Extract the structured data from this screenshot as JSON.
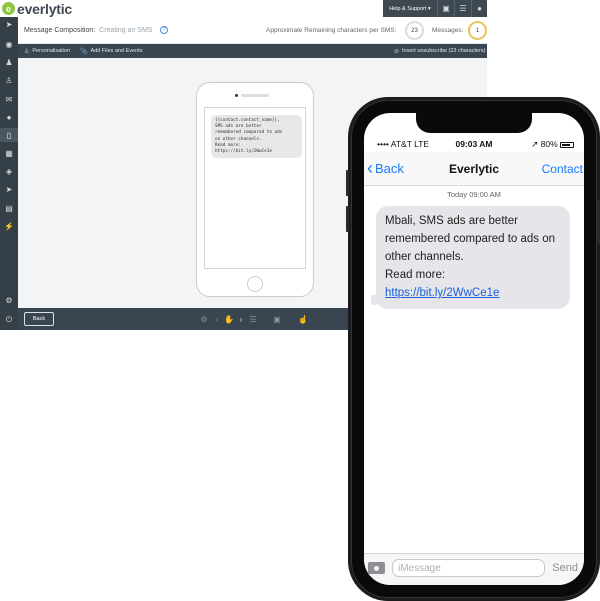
{
  "app": {
    "brand": "everlytic",
    "brand_mark": "e",
    "help_label": "Help & Support ▾",
    "header": {
      "title": "Message Composition:",
      "subtitle": "Creating an SMS",
      "chars_label": "Approximate Remaining characters per SMS:",
      "chars_value": "23",
      "messages_label": "Messages:",
      "messages_value": "1"
    },
    "toolbar": {
      "personalisation": "Personalisation",
      "add_files": "Add Files and Events",
      "unsubscribe": "Insert unsubscribe (23 characters)"
    },
    "preview_message": "{{contact.contact_name}},\nSMS ads are better\nremembered compared to ads\non other channels.\nRead more:\nhttps://bit.ly/2WwCe1e",
    "back_label": "Back"
  },
  "phone": {
    "status": {
      "carrier": "•••• AT&T LTE",
      "time": "09:03 AM",
      "battery": "↗ 80%"
    },
    "nav": {
      "back": "Back",
      "title": "Everlytic",
      "contact": "Contact"
    },
    "timestamp": "Today 09:00 AM",
    "message_text": "Mbali, SMS ads are better remembered compared to ads on other channels.\nRead more:",
    "message_link": "https://bit.ly/2WwCe1e",
    "input_placeholder": "iMessage",
    "send_label": "Send"
  },
  "colors": {
    "sidebar": "#343f47",
    "toolbar": "#394550",
    "brand_green": "#8dc63f",
    "ios_blue": "#1b7bff",
    "bubble_gray": "#e5e5ea"
  },
  "icons": {
    "sidebar": [
      "megaphone-icon",
      "dashboard-icon",
      "contacts-icon",
      "user-icon",
      "email-icon",
      "notification-icon",
      "sms-icon",
      "network-icon",
      "palette-icon",
      "send-icon",
      "document-icon",
      "lightning-icon",
      "settings-icon",
      "power-icon"
    ],
    "bottom": [
      "settings-icon",
      "hand-icon",
      "list-icon",
      "image-icon",
      "thumbs-up-icon"
    ]
  },
  "battery_level": 0.8
}
